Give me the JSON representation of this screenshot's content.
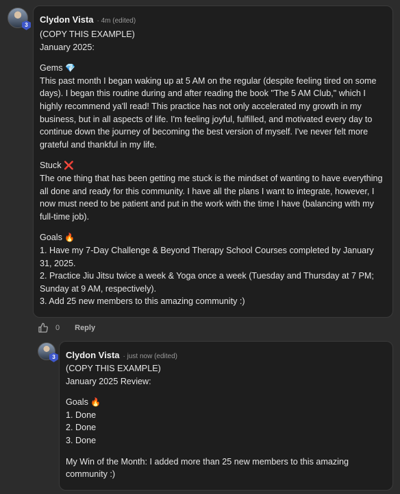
{
  "comment": {
    "author": "Clydon Vista",
    "meta": "· 4m (edited)",
    "avatar_level": "3",
    "lines_top": [
      "(COPY THIS EXAMPLE)",
      "January 2025:"
    ],
    "gems_title": "Gems",
    "gems_emoji": "💎",
    "gems_text": "This past month I began waking up at 5 AM on the regular (despite feeling tired on some days). I began this routine during and after reading the book \"The 5 AM Club,\" which I highly recommend ya'll read! This practice has not only accelerated my growth in my business, but in all aspects of life. I'm feeling joyful, fulfilled, and motivated every day to continue down the journey of becoming the best version of myself. I've never felt more grateful and thankful in my life.",
    "stuck_title": "Stuck",
    "stuck_emoji": "❌",
    "stuck_text": "The one thing that has been getting me stuck is the mindset of wanting to have everything all done and ready for this community. I have all the plans I want to integrate, however, I now must need to be patient and put in the work with the time I have (balancing with my full-time job).",
    "goals_title": "Goals",
    "goals_emoji": "🔥",
    "goals": [
      "1. Have my 7-Day Challenge & Beyond Therapy School Courses completed by January 31, 2025.",
      "2. Practice Jiu Jitsu twice a week & Yoga once a week (Tuesday and Thursday at 7 PM; Sunday at 9 AM, respectively).",
      "3. Add 25 new members to this amazing community :)"
    ],
    "like_count": "0",
    "reply_label": "Reply"
  },
  "reply": {
    "author": "Clydon Vista",
    "meta": "· just now (edited)",
    "avatar_level": "3",
    "lines_top": [
      "(COPY THIS EXAMPLE)",
      "January 2025 Review:"
    ],
    "goals_title": "Goals",
    "goals_emoji": "🔥",
    "goals": [
      "1. Done",
      "2. Done",
      "3. Done"
    ],
    "win_text": "My Win of the Month: I added more than 25 new members to this amazing community :)"
  },
  "colors": {
    "background": "#2c2c2c",
    "bubble": "#1e1e1e",
    "level_badge": "#3e57c9"
  }
}
